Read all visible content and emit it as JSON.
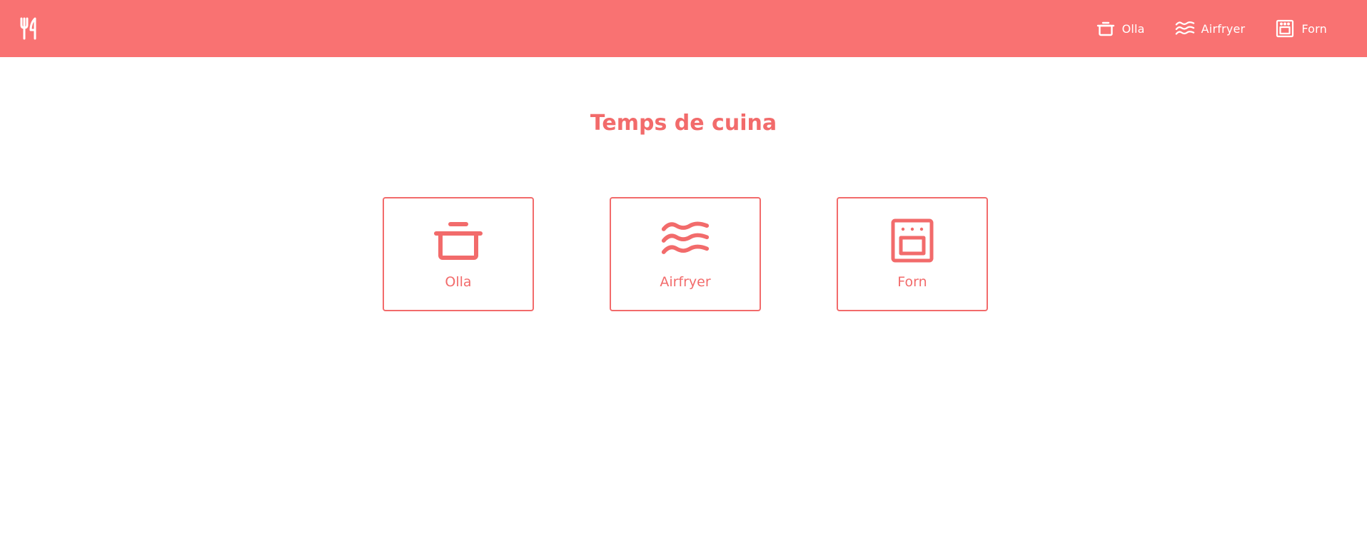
{
  "header": {
    "logo_icon": "fork-knife-icon",
    "nav": [
      {
        "label": "Olla",
        "icon": "pot-icon"
      },
      {
        "label": "Airfryer",
        "icon": "waves-icon"
      },
      {
        "label": "Forn",
        "icon": "oven-icon"
      }
    ]
  },
  "main": {
    "title": "Temps de cuina",
    "cards": [
      {
        "label": "Olla",
        "icon": "pot-icon"
      },
      {
        "label": "Airfryer",
        "icon": "waves-icon"
      },
      {
        "label": "Forn",
        "icon": "oven-icon"
      }
    ]
  },
  "colors": {
    "accent": "#f97272",
    "accent_text": "#f26b6b",
    "background": "#ffffff"
  }
}
